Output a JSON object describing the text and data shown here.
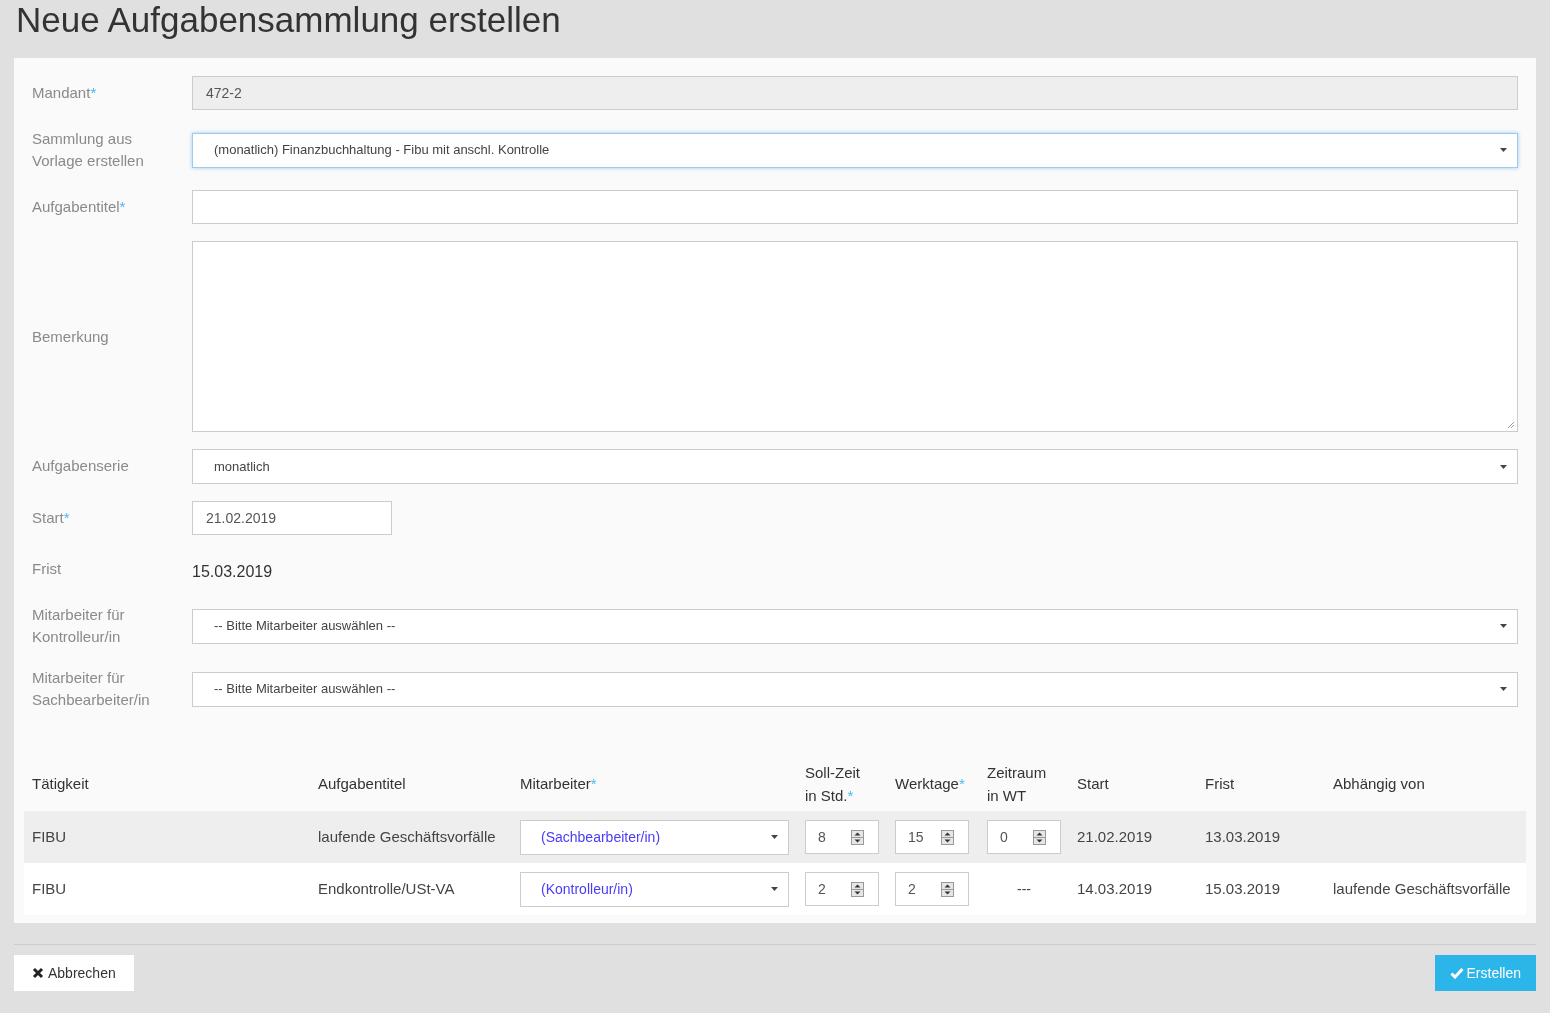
{
  "title": "Neue Aufgabensammlung erstellen",
  "fields": [
    {
      "label": "Mandant",
      "required_mark": "*",
      "kind": "readonly",
      "value": "472-2"
    },
    {
      "label": "Sammlung aus Vorlage erstellen",
      "kind": "select",
      "value": "(monatlich) Finanzbuchhaltung - Fibu mit anschl. Kontrolle",
      "focused": true
    },
    {
      "label": "Aufgabentitel",
      "required_mark": "*",
      "kind": "text"
    },
    {
      "label": "Bemerkung",
      "kind": "textarea"
    },
    {
      "label": "Aufgabenserie",
      "kind": "select",
      "value": "monatlich",
      "focused": false
    },
    {
      "label": "Start",
      "required_mark": "*",
      "kind": "date",
      "value": "21.02.2019"
    },
    {
      "label": "Frist",
      "kind": "static",
      "value": "15.03.2019"
    },
    {
      "label": "Mitarbeiter für Kontrolleur/in",
      "kind": "select",
      "value": "-- Bitte Mitarbeiter auswählen --",
      "focused": false
    },
    {
      "label": "Mitarbeiter für Sachbearbeiter/in",
      "kind": "select",
      "value": "-- Bitte Mitarbeiter auswählen --",
      "focused": false
    }
  ],
  "table": {
    "columns": [
      {
        "label": "Tätigkeit"
      },
      {
        "label": "Aufgabentitel"
      },
      {
        "label": "Mitarbeiter",
        "required_mark": "*"
      },
      {
        "label": "Soll-Zeit in Std.",
        "required_mark": "*"
      },
      {
        "label": "Werktage",
        "required_mark": "*"
      },
      {
        "label": "Zeitraum in WT"
      },
      {
        "label": "Start"
      },
      {
        "label": "Frist"
      },
      {
        "label": "Abhängig von"
      }
    ],
    "rows": [
      {
        "taetigkeit": "FIBU",
        "aufgabentitel": "laufende Geschäftsvorfälle",
        "mitarbeiter": "(Sachbearbeiter/in)",
        "soll_zeit": "8",
        "werktage": "15",
        "zeitraum": {
          "kind": "spin",
          "value": "0"
        },
        "start": "21.02.2019",
        "frist": "13.03.2019"
      },
      {
        "taetigkeit": "FIBU",
        "aufgabentitel": "Endkontrolle/USt-VA",
        "mitarbeiter": "(Kontrolleur/in)",
        "soll_zeit": "2",
        "werktage": "2",
        "zeitraum": {
          "kind": "text",
          "value": "---"
        },
        "start": "14.03.2019",
        "frist": "15.03.2019",
        "abhaengig_von": "laufende Geschäftsvorfälle"
      }
    ]
  },
  "buttons": {
    "cancel": "Abbrechen",
    "submit": "Erstellen"
  }
}
